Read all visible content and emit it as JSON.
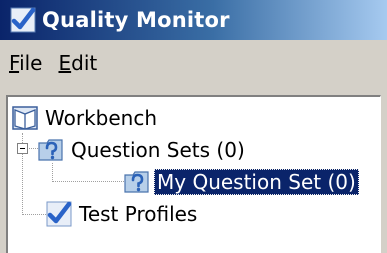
{
  "window": {
    "title": "Quality Monitor",
    "title_icon": "checkmark-icon"
  },
  "menu": {
    "file": {
      "mnemonic": "F",
      "rest": "ile"
    },
    "edit": {
      "mnemonic": "E",
      "rest": "dit"
    }
  },
  "tree": {
    "root": {
      "label": "Workbench",
      "icon": "book-icon"
    },
    "question_sets": {
      "label": "Question Sets (0)",
      "icon": "question-folder-icon",
      "expanded": true
    },
    "my_question_set": {
      "label": "My Question Set (0)",
      "icon": "question-folder-icon",
      "selected": true
    },
    "test_profiles": {
      "label": "Test Profiles",
      "icon": "checkmark-icon"
    }
  },
  "colors": {
    "title_gradient_start": "#0a246a",
    "title_gradient_end": "#a6caf0",
    "selection": "#0a246a",
    "window_face": "#d4d0c8"
  }
}
